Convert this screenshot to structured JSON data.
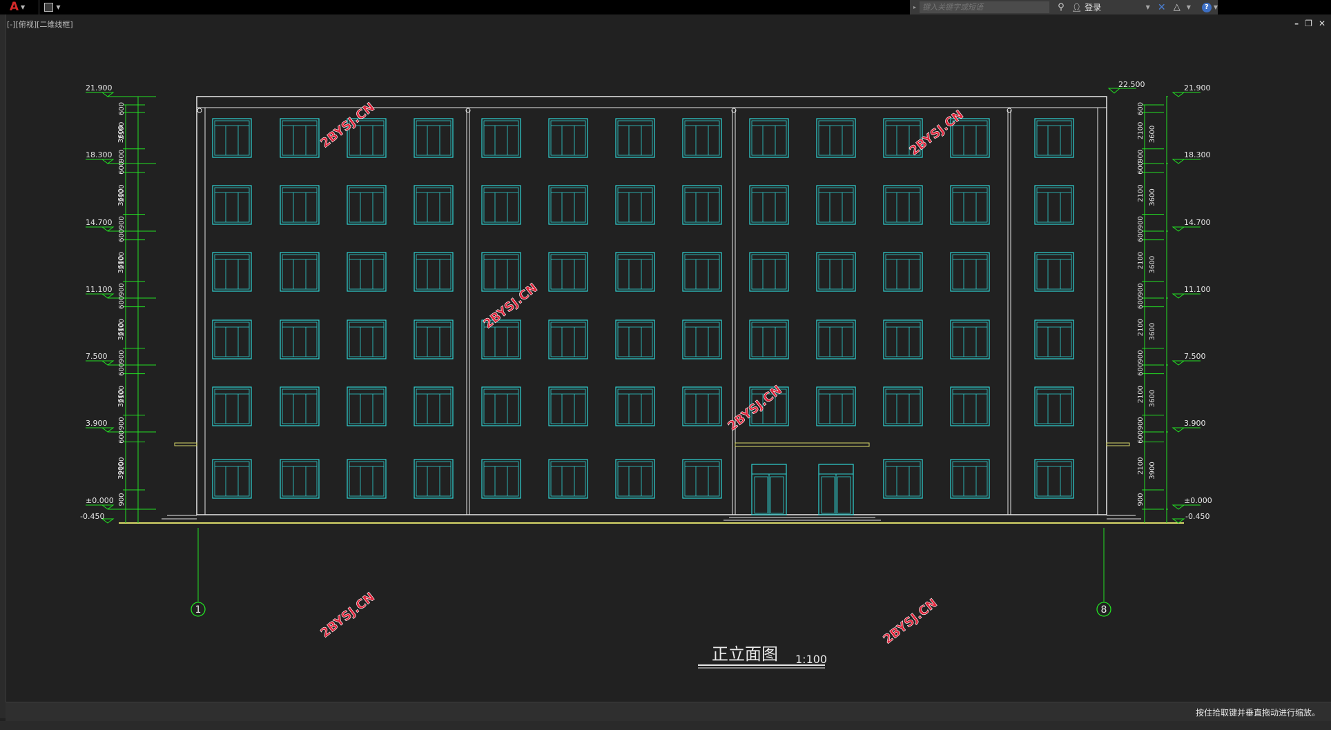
{
  "titlebar": {
    "search_placeholder": "键入关键字或短语",
    "login_label": "登录"
  },
  "viewport": {
    "label": "[-][俯视][二维线框]"
  },
  "drawing": {
    "title": "正立面图",
    "scale": "1:100",
    "watermark": "2BYSJ.CN",
    "grid_labels": [
      "1",
      "8"
    ],
    "top_elevation": "22.500",
    "floor_elevations": [
      "21.900",
      "18.300",
      "14.700",
      "11.100",
      "7.500",
      "3.900",
      "±0.000"
    ],
    "ground_elevation": "-0.450",
    "dims_left": [
      "600",
      "2100",
      "900",
      "3600",
      "3900"
    ],
    "dims_right": [
      "600",
      "2100",
      "900",
      "3600",
      "3900"
    ],
    "window_columns": 13,
    "floors": 6
  },
  "statusbar": {
    "text": "按住拾取键并垂直拖动进行缩放。"
  },
  "colors": {
    "background": "#212121",
    "line_white": "#e8e8e8",
    "window_cyan": "#2fd3d3",
    "dim_green": "#22e122",
    "accent_yellow": "#d9d96a",
    "watermark_red": "#e0233a"
  }
}
